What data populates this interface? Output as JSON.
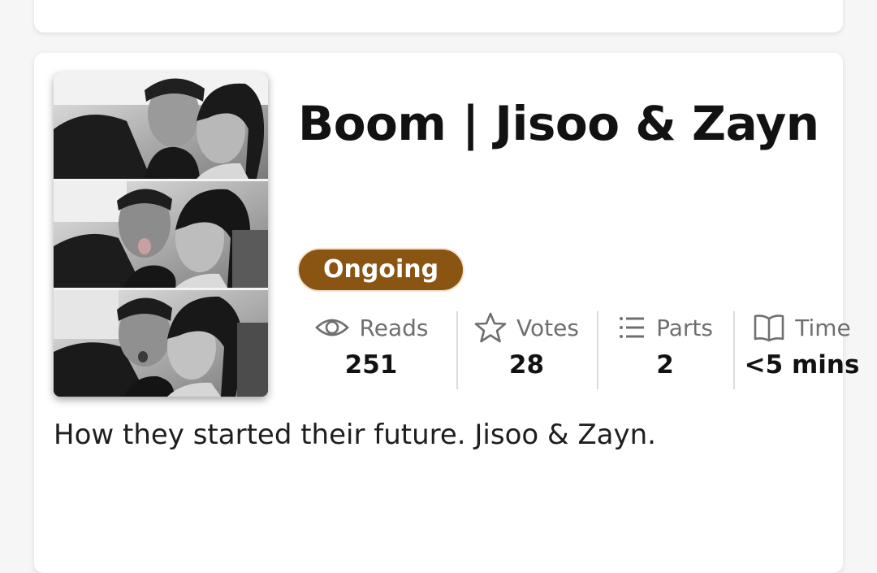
{
  "story": {
    "title": "Boom | Jisoo & Zayn",
    "status": "Ongoing",
    "description": "How they started their future. Jisoo & Zayn.",
    "cover_alt": "photo-booth-cover"
  },
  "stats": {
    "reads": {
      "label": "Reads",
      "value": "251",
      "icon": "eye-icon"
    },
    "votes": {
      "label": "Votes",
      "value": "28",
      "icon": "star-icon"
    },
    "parts": {
      "label": "Parts",
      "value": "2",
      "icon": "list-icon"
    },
    "time": {
      "label": "Time",
      "value": "<5 mins",
      "icon": "book-icon"
    }
  },
  "colors": {
    "status_badge": "#8a5513",
    "text_primary": "#121212",
    "text_secondary": "#6f6f6f"
  }
}
